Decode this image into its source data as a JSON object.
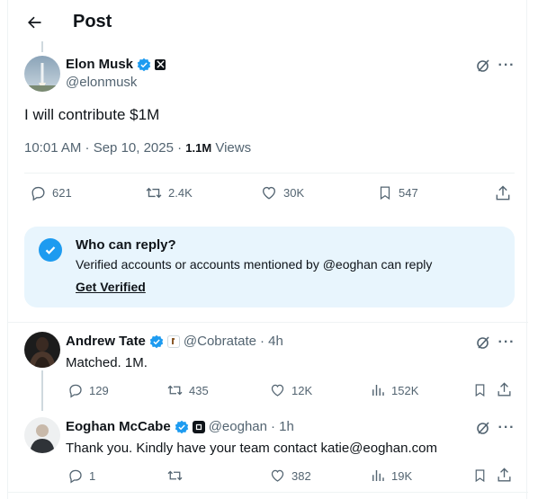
{
  "header": {
    "title": "Post"
  },
  "post": {
    "author_name": "Elon Musk",
    "author_handle": "@elonmusk",
    "text": "I will contribute $1M",
    "timestamp": "10:01 AM · Sep 10, 2025 · ",
    "views_count": "1.1M",
    "views_label": " Views",
    "stats": {
      "replies": "621",
      "reposts": "2.4K",
      "likes": "30K",
      "bookmarks": "547"
    }
  },
  "reply_restriction": {
    "title": "Who can reply?",
    "description": "Verified accounts or accounts mentioned by @eoghan can reply",
    "link": "Get Verified"
  },
  "replies": [
    {
      "author_name": "Andrew Tate",
      "author_handle": "@Cobratate",
      "time": "· 4h",
      "text": "Matched. 1M.",
      "stats": {
        "replies": "129",
        "reposts": "435",
        "likes": "12K",
        "views": "152K"
      }
    },
    {
      "author_name": "Eoghan McCabe",
      "author_handle": "@eoghan",
      "time": "· 1h",
      "text": "Thank you. Kindly have your team contact katie@eoghan.com",
      "stats": {
        "replies": "1",
        "reposts": "",
        "likes": "382",
        "views": "19K"
      }
    }
  ],
  "colors": {
    "accent": "#1d9bf0",
    "muted": "#536471",
    "reply_box_bg": "#e8f5fd"
  },
  "icons": [
    "back-arrow-icon",
    "verified-badge-icon",
    "x-affiliate-icon",
    "grok-icon",
    "more-icon",
    "reply-icon",
    "repost-icon",
    "like-icon",
    "bookmark-icon",
    "share-icon",
    "views-icon"
  ]
}
